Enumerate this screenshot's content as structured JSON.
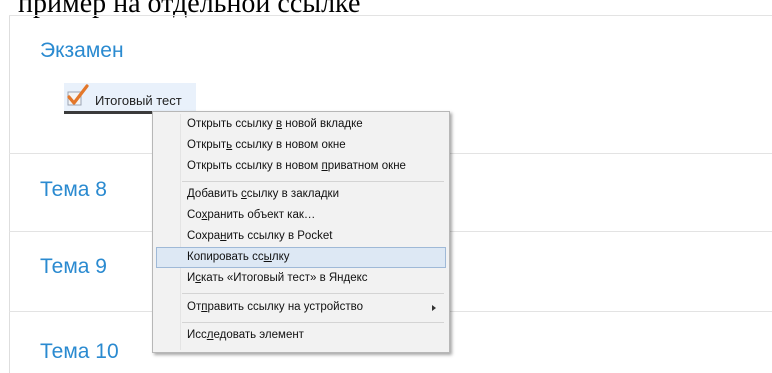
{
  "top_text": "пример на отдельной ссылке",
  "sections": [
    {
      "title": "Экзамен"
    },
    {
      "title": "Тема 8"
    },
    {
      "title": "Тема 9"
    },
    {
      "title": "Тема 10"
    }
  ],
  "activity": {
    "label": "Итоговый тест",
    "icon": "quiz-checkmark-icon"
  },
  "context_menu": {
    "items": [
      {
        "pre": "Открыть ссылку ",
        "acc": "в",
        "post": " новой вкладке"
      },
      {
        "pre": "Открыт",
        "acc": "ь",
        "post": " ссылку в новом окне"
      },
      {
        "pre": "Открыть ссылку в новом ",
        "acc": "п",
        "post": "риватном окне"
      },
      {
        "pre": "Добавить ",
        "acc": "с",
        "post": "сылку в закладки"
      },
      {
        "pre": "Со",
        "acc": "х",
        "post": "ранить объект как…"
      },
      {
        "pre": "Сохра",
        "acc": "н",
        "post": "ить ссылку в Pocket"
      },
      {
        "pre": "Копировать сс",
        "acc": "ы",
        "post": "лку"
      },
      {
        "pre": "И",
        "acc": "с",
        "post": "кать «Итоговый тест» в Яндекс"
      },
      {
        "pre": "От",
        "acc": "п",
        "post": "равить ссылку на устройство"
      },
      {
        "pre": "Исс",
        "acc": "л",
        "post": "едовать элемент"
      }
    ],
    "highlighted_index": 6,
    "submenu_index": 8
  },
  "colors": {
    "section_title": "#2a8ad0",
    "menu_bg": "#f2f2f2",
    "menu_highlight": "#dde8f4",
    "activity_bg": "#e9f1fb"
  }
}
